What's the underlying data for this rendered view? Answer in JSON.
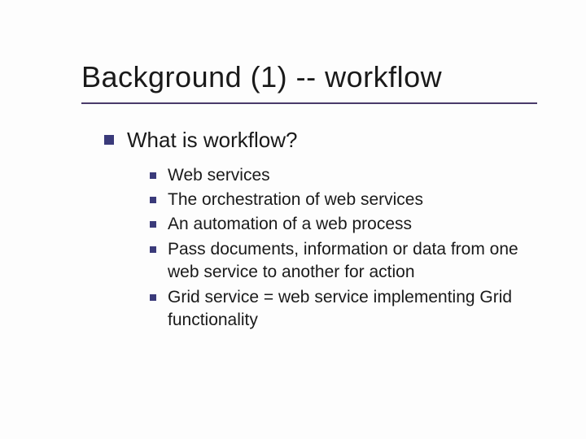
{
  "slide": {
    "title": "Background (1) -- workflow",
    "level1": {
      "text": "What is workflow?"
    },
    "level2": [
      {
        "text": "Web services"
      },
      {
        "text": "The orchestration of web services"
      },
      {
        "text": "An automation of a web process"
      },
      {
        "text": "Pass documents, information or data from one web service to another for action"
      },
      {
        "text": "Grid service = web service implementing Grid functionality"
      }
    ]
  }
}
